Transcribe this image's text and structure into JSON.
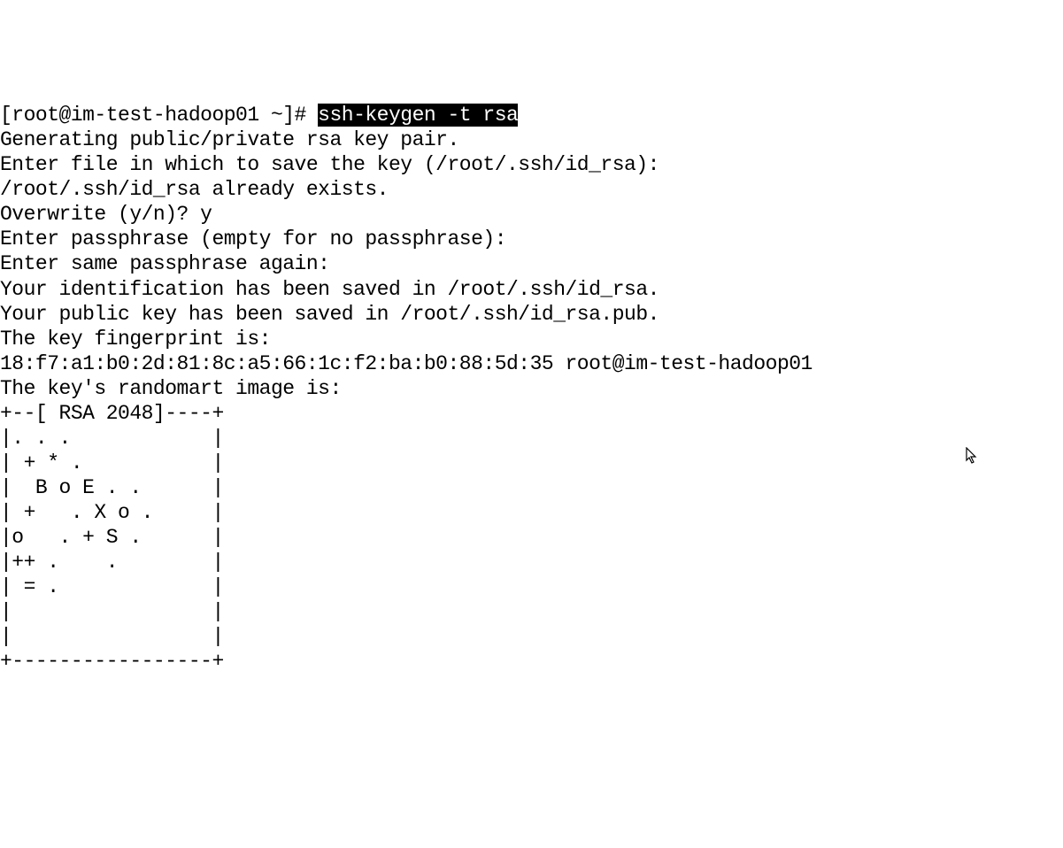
{
  "terminal": {
    "prompt": "[root@im-test-hadoop01 ~]# ",
    "command": "ssh-keygen -t rsa",
    "lines": [
      "Generating public/private rsa key pair.",
      "Enter file in which to save the key (/root/.ssh/id_rsa):",
      "/root/.ssh/id_rsa already exists.",
      "Overwrite (y/n)? y",
      "Enter passphrase (empty for no passphrase):",
      "Enter same passphrase again:",
      "Your identification has been saved in /root/.ssh/id_rsa.",
      "Your public key has been saved in /root/.ssh/id_rsa.pub.",
      "The key fingerprint is:",
      "18:f7:a1:b0:2d:81:8c:a5:66:1c:f2:ba:b0:88:5d:35 root@im-test-hadoop01",
      "The key's randomart image is:",
      "+--[ RSA 2048]----+",
      "|. . .            |",
      "| + * .           |",
      "|  B o E . .      |",
      "| +   . X o .     |",
      "|o   . + S .      |",
      "|++ .    .        |",
      "| = .             |",
      "|                 |",
      "|                 |",
      "+-----------------+"
    ]
  }
}
